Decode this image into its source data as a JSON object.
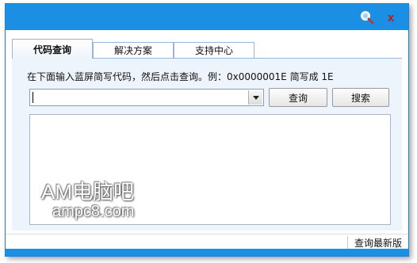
{
  "titlebar": {
    "search_icon": "magnifier-icon",
    "close_label": "x",
    "accent_color": "#1a8fe3"
  },
  "tabs": [
    {
      "label": "代码查询",
      "active": true
    },
    {
      "label": "解决方案",
      "active": false
    },
    {
      "label": "支持中心",
      "active": false
    }
  ],
  "query": {
    "hint": "在下面输入蓝屏简写代码，然后点击查询。例：0x0000001E 简写成 1E",
    "code_input_value": "",
    "query_button": "查询",
    "search_button": "搜索"
  },
  "result": {
    "text": ""
  },
  "watermark": {
    "line1": "AM电脑吧",
    "line2": "ampc8.com"
  },
  "status": {
    "update_link": "查询最新版"
  }
}
